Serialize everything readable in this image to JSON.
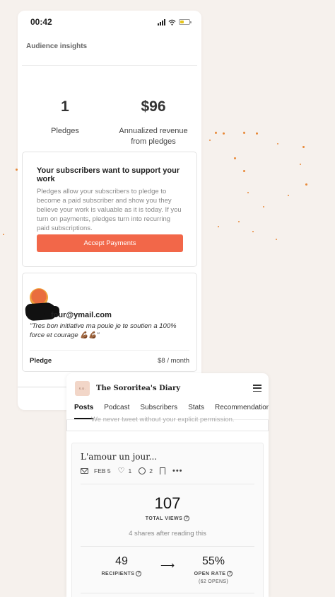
{
  "status_bar": {
    "time": "00:42"
  },
  "insights": {
    "section_title": "Audience insights",
    "pledges_value": "1",
    "pledges_label": "Pledges",
    "revenue_value": "$96",
    "revenue_label": "Annualized revenue from pledges"
  },
  "support_card": {
    "title": "Your subscribers want to support your work",
    "body": "Pledges allow your subscribers to pledge to become a paid subscriber and show you they believe your work is valuable as it is today. If you turn on payments, pledges turn into recurring paid subscriptions.",
    "button_label": "Accept Payments"
  },
  "pledge_card": {
    "email": "four@ymail.com",
    "quote": "\"Tres bon initiative ma poule je te soutien a 100% force et courage 💪🏾💪🏾\"",
    "pledge_label": "Pledge",
    "pledge_amount": "$8 / month"
  },
  "publication": {
    "logo_text": "S.D.",
    "name": "The Sororitea's Diary",
    "tabs": [
      "Posts",
      "Podcast",
      "Subscribers",
      "Stats",
      "Recommendations"
    ],
    "active_tab": "Posts",
    "ghost_text": "We never tweet without your explicit permission."
  },
  "post": {
    "title": "L'amour un jour...",
    "date": "FEB 5",
    "likes": "1",
    "comments": "2",
    "views": "107",
    "views_label": "TOTAL VIEWS",
    "shares": "4 shares after reading this",
    "recipients": "49",
    "recipients_label": "RECIPIENTS",
    "open_rate": "55%",
    "open_rate_label": "OPEN RATE",
    "opens": "(62 OPENS)"
  },
  "colors": {
    "accent": "#f26749",
    "background": "#f6f1ed",
    "dots": "#e88a3a"
  }
}
